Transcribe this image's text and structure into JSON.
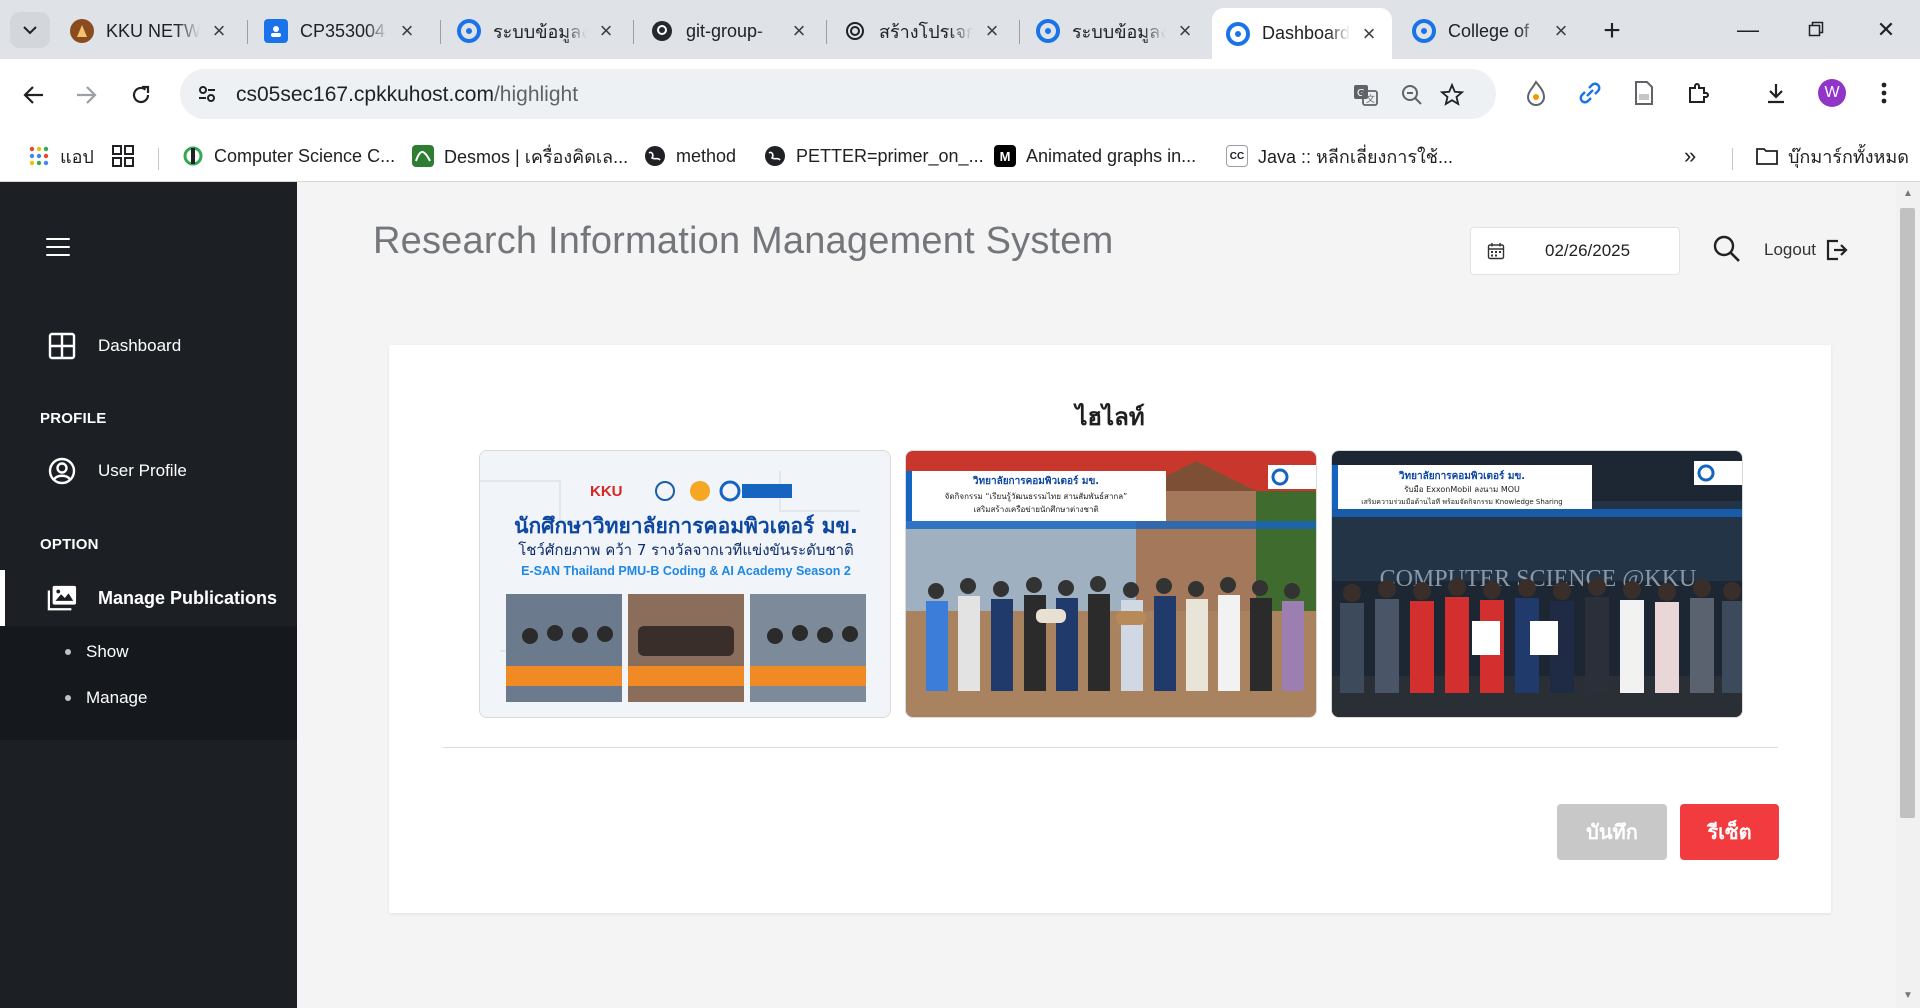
{
  "browser": {
    "tabs": [
      {
        "label": "KKU NETW",
        "icon": "kku-seal-icon"
      },
      {
        "label": "CP353004",
        "icon": "classroom-icon"
      },
      {
        "label": "ระบบข้อมูลง",
        "icon": "cp-logo-icon"
      },
      {
        "label": "git-group-",
        "icon": "github-icon"
      },
      {
        "label": "สร้างโปรเจกต",
        "icon": "chatgpt-icon"
      },
      {
        "label": "ระบบข้อมูลง",
        "icon": "cp-logo-icon"
      },
      {
        "label": "Dashboard",
        "icon": "cp-logo-icon",
        "active": true
      },
      {
        "label": "College of",
        "icon": "cp-logo-icon"
      }
    ],
    "url_host": "cs05sec167.cpkkuhost.com",
    "url_path": "/highlight",
    "profile_initial": "W",
    "bookmarks": [
      {
        "label": "แอป",
        "icon": "apps-grid-icon"
      },
      {
        "label": "",
        "icon": "tab-groups-icon"
      },
      {
        "label": "Computer Science C...",
        "icon": "cs-logo-icon"
      },
      {
        "label": "Desmos | เครื่องคิดเล...",
        "icon": "desmos-icon"
      },
      {
        "label": "method",
        "icon": "globe-icon"
      },
      {
        "label": "PETTER=primer_on_...",
        "icon": "globe-icon"
      },
      {
        "label": "Animated graphs in...",
        "icon": "medium-icon"
      },
      {
        "label": "Java :: หลีกเลี่ยงการใช้...",
        "icon": "cc-icon"
      }
    ],
    "all_bookmarks_label": "บุ๊กมาร์กทั้งหมด",
    "accent": "#1a73e8"
  },
  "sidebar": {
    "dashboard_label": "Dashboard",
    "profile_heading": "PROFILE",
    "user_profile_label": "User Profile",
    "option_heading": "OPTION",
    "manage_publications_label": "Manage Publications",
    "sub_items": [
      "Show",
      "Manage"
    ],
    "bg_color": "#1c1f24"
  },
  "header": {
    "title": "Research Information Management System",
    "date_value": "02/26/2025",
    "logout_label": "Logout"
  },
  "highlight": {
    "title": "ไฮไลท์",
    "images": [
      {
        "banner_top": "นักศึกษาวิทยาลัยการคอมพิวเตอร์ มข.",
        "banner_mid": "โชว์ศักยภาพ คว้า 7 รางวัลจากเวทีแข่งขันระดับชาติ",
        "banner_sub": "E-SAN Thailand PMU-B Coding & AI Academy Season 2",
        "logo_text": "KKU"
      },
      {
        "banner_top": "วิทยาลัยการคอมพิวเตอร์ มข.",
        "banner_mid": "จัดกิจกรรม “เรียนรู้วัฒนธรรมไทย สานสัมพันธ์สากล”",
        "banner_sub": "เสริมสร้างเครือข่ายนักศึกษาต่างชาติ"
      },
      {
        "banner_top": "วิทยาลัยการคอมพิวเตอร์ มข.",
        "banner_mid": "รับมือ ExxonMobil ลงนาม MOU",
        "banner_sub": "เสริมความร่วมมือด้านไอที พร้อมจัดกิจกรรม Knowledge Sharing",
        "wall_text": "COMPUTER SCIENCE @KKU"
      }
    ],
    "save_label": "บันทึก",
    "reset_label": "รีเซ็ต",
    "reset_color": "#f23b3e",
    "save_color": "#c8c8c8"
  }
}
